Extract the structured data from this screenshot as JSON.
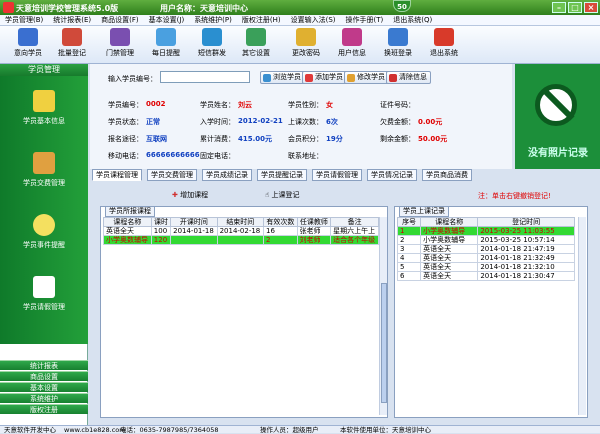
{
  "window": {
    "title": "天意培训学校管理系统5.0版",
    "user_label": "用户名称：天意培训中心",
    "badge": "50"
  },
  "menu": [
    "学员管理(B)",
    "统计报表(E)",
    "商品设置(F)",
    "基本设置(J)",
    "系统维护(P)",
    "版权注册(H)",
    "设置输入法(S)",
    "操作手册(T)",
    "退出系统(Q)"
  ],
  "toolbar": [
    "意向学员",
    "批量登记",
    "门禁管理",
    "每日提醒",
    "短信群发",
    "其它设置",
    "更改密码",
    "用户信息",
    "换班登录",
    "退出系统"
  ],
  "sidebar": {
    "header": "学员管理",
    "items": [
      "学员基本信息",
      "学员交费管理",
      "学员事件提醒",
      "学员请假管理"
    ],
    "footer": [
      "统计报表",
      "商品设置",
      "基本设置",
      "系统维护",
      "版权注册"
    ]
  },
  "form": {
    "input_label": "输入学员编号：",
    "input_value": "",
    "buttons": [
      "浏览学员",
      "添加学员",
      "修改学员",
      "清除信息"
    ],
    "fields": {
      "student_id_label": "学员编号：",
      "student_id": "0002",
      "name_label": "学员姓名：",
      "name": "刘云",
      "gender_label": "学员性别：",
      "gender": "女",
      "cert_label": "证件号码：",
      "cert": "",
      "status_label": "学员状态：",
      "status": "正常",
      "enroll_label": "入学时间：",
      "enroll": "2012-02-21",
      "classes_label": "上课次数：",
      "classes": "6次",
      "debt_label": "欠费金额：",
      "debt": "0.00元",
      "channel_label": "报名途径：",
      "channel": "互联网",
      "total_label": "累计消费：",
      "total": "415.00元",
      "points_label": "会员积分：",
      "points": "19分",
      "balance_label": "剩余金额：",
      "balance": "50.00元",
      "phone_label": "移动电话：",
      "phone": "66666666666",
      "landline_label": "固定电话：",
      "landline": "",
      "address_label": "联系地址：",
      "address": ""
    }
  },
  "banner": {
    "text": "没有照片记录"
  },
  "tabs": [
    "学员课程管理",
    "学员交费管理",
    "学员成绩记录",
    "学员提醒记录",
    "学员请假管理",
    "学员情况记录",
    "学员商品消费"
  ],
  "actions": {
    "add_course": "增加课程",
    "checkin": "上课登记",
    "note": "注：单击右键撤销登记!"
  },
  "courses": {
    "title": "学员所报课程",
    "headers": [
      "课程名称",
      "课时",
      "开课时间",
      "结束时间",
      "有效次数",
      "任课教师",
      "备注"
    ],
    "rows": [
      [
        "英语全天",
        "100",
        "2014-01-18",
        "2014-02-18",
        "16",
        "张老师",
        "星期六上午上"
      ],
      [
        "小学奥数辅导",
        "120",
        "",
        "",
        "2",
        "刘老师",
        "适合各个年级"
      ]
    ]
  },
  "checkins": {
    "title": "学员上课记录",
    "headers": [
      "序号",
      "课程名称",
      "登记时间"
    ],
    "rows": [
      [
        "1",
        "小学奥数辅导",
        "2015-03-25 11:03:55"
      ],
      [
        "2",
        "小学奥数辅导",
        "2015-03-25 10:57:14"
      ],
      [
        "3",
        "英语全天",
        "2014-01-18 21:47:19"
      ],
      [
        "4",
        "英语全天",
        "2014-01-18 21:32:49"
      ],
      [
        "5",
        "英语全天",
        "2014-01-18 21:32:10"
      ],
      [
        "6",
        "英语全天",
        "2014-01-18 21:30:47"
      ]
    ]
  },
  "status": {
    "company": "天意软件开发中心",
    "site": "www.cb1e828.com",
    "phone": "电话：0635-7987985/7364058",
    "operator": "操作人员：超级用户",
    "unit": "本软件使用单位：天意培训中心"
  },
  "colors": {
    "green": "#1c8f3a",
    "red": "#e00000",
    "blue": "#1040c0"
  }
}
